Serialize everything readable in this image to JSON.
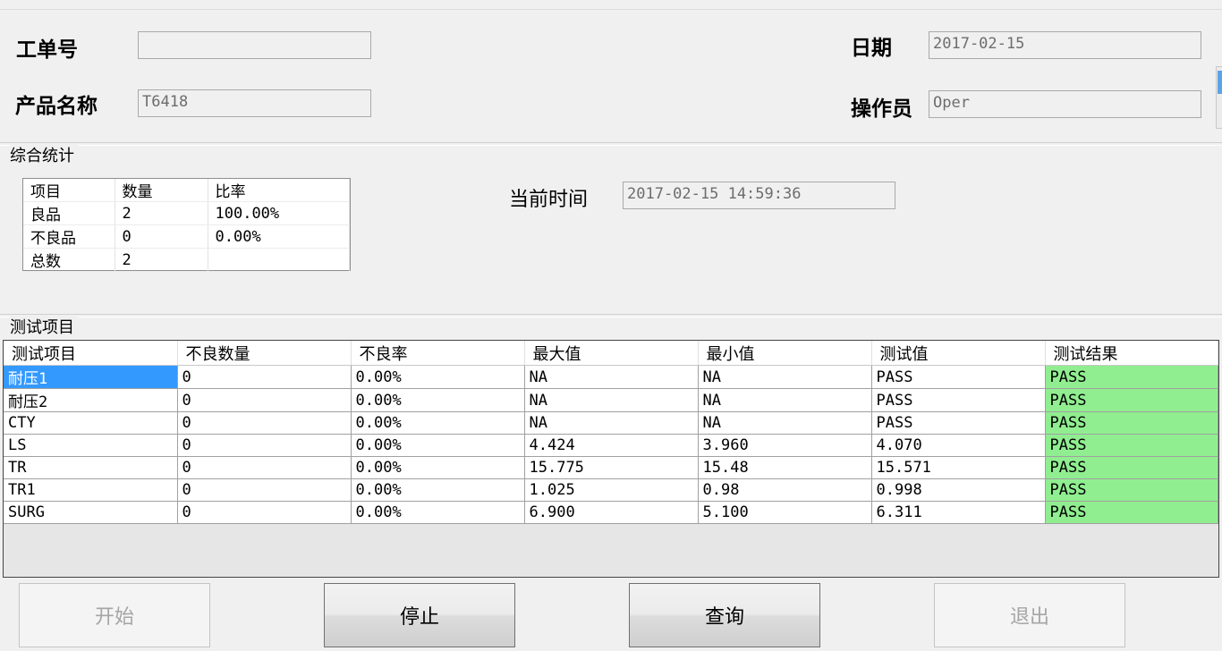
{
  "header": {
    "order_label": "工单号",
    "order_value": "",
    "product_label": "产品名称",
    "product_value": "T6418",
    "date_label": "日期",
    "date_value": "2017-02-15",
    "operator_label": "操作员",
    "operator_value": "Oper"
  },
  "summary": {
    "title": "综合统计",
    "columns": [
      "项目",
      "数量",
      "比率"
    ],
    "rows": [
      [
        "良品",
        "2",
        "100.00%"
      ],
      [
        "不良品",
        "0",
        "0.00%"
      ],
      [
        "总数",
        "2",
        ""
      ]
    ],
    "current_time_label": "当前时间",
    "current_time_value": "2017-02-15 14:59:36"
  },
  "tests": {
    "title": "测试项目",
    "columns": [
      "测试项目",
      "不良数量",
      "不良率",
      "最大值",
      "最小值",
      "测试值",
      "测试结果"
    ],
    "rows": [
      [
        "耐压1",
        "0",
        "0.00%",
        "NA",
        "NA",
        "PASS",
        "PASS"
      ],
      [
        "耐压2",
        "0",
        "0.00%",
        "NA",
        "NA",
        "PASS",
        "PASS"
      ],
      [
        "CTY",
        "0",
        "0.00%",
        "NA",
        "NA",
        "PASS",
        "PASS"
      ],
      [
        "LS",
        "0",
        "0.00%",
        "4.424",
        "3.960",
        "4.070",
        "PASS"
      ],
      [
        "TR",
        "0",
        "0.00%",
        "15.775",
        "15.48",
        "15.571",
        "PASS"
      ],
      [
        "TR1",
        "0",
        "0.00%",
        "1.025",
        "0.98",
        "0.998",
        "PASS"
      ],
      [
        "SURG",
        "0",
        "0.00%",
        "6.900",
        "5.100",
        "6.311",
        "PASS"
      ]
    ],
    "pass_color": "#90ee90",
    "selected_color": "#3399ff"
  },
  "buttons": {
    "start": "开始",
    "stop": "停止",
    "query": "查询",
    "exit": "退出"
  }
}
